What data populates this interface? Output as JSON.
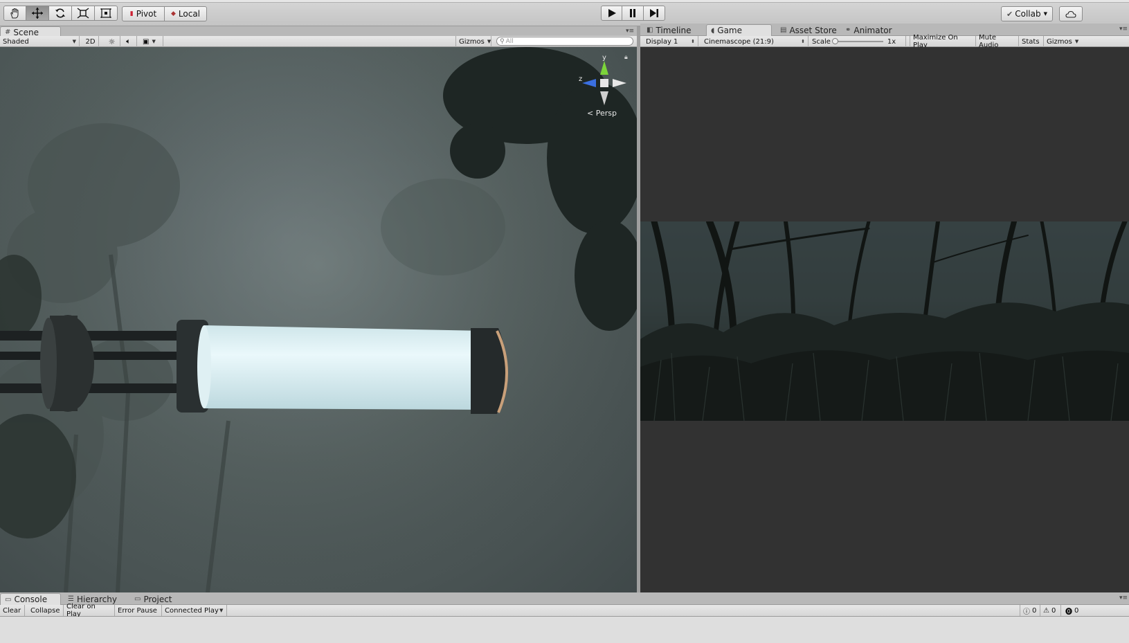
{
  "toolbar": {
    "tools": [
      {
        "name": "hand-tool",
        "icon": "hand-icon"
      },
      {
        "name": "move-tool",
        "icon": "move-arrows-icon"
      },
      {
        "name": "rotate-tool",
        "icon": "rotate-icon"
      },
      {
        "name": "scale-tool",
        "icon": "scale-icon"
      },
      {
        "name": "rect-tool",
        "icon": "rect-transform-icon"
      }
    ],
    "pivot_label": "Pivot",
    "local_label": "Local",
    "collab_label": "Collab",
    "cloud_icon": "cloud-icon",
    "play_icon": "play-icon",
    "pause_icon": "pause-icon",
    "step_icon": "step-icon"
  },
  "scene_panel": {
    "tab_label": "Scene",
    "shading_mode": "Shaded",
    "mode_2d_label": "2D",
    "gizmos_label": "Gizmos",
    "search_placeholder": "All",
    "projection_label": "Persp",
    "axis_y": "y",
    "axis_z": "z"
  },
  "game_panel": {
    "tabs": [
      {
        "label": "Timeline",
        "icon": "timeline-icon"
      },
      {
        "label": "Game",
        "icon": "game-icon"
      },
      {
        "label": "Asset Store",
        "icon": "asset-store-icon"
      },
      {
        "label": "Animator",
        "icon": "animator-icon"
      }
    ],
    "display_label": "Display 1",
    "aspect_label": "Cinemascope (21:9)",
    "scale_label": "Scale",
    "scale_value": "1x",
    "maximize_label": "Maximize On Play",
    "mute_label": "Mute Audio",
    "stats_label": "Stats",
    "gizmos_label": "Gizmos"
  },
  "console_panel": {
    "tabs": [
      {
        "label": "Console",
        "icon": "console-icon"
      },
      {
        "label": "Hierarchy",
        "icon": "hierarchy-icon"
      },
      {
        "label": "Project",
        "icon": "folder-icon"
      }
    ],
    "buttons": [
      "Clear",
      "Collapse",
      "Clear on Play",
      "Error Pause",
      "Connected Player"
    ],
    "counts": {
      "info": "0",
      "warning": "0",
      "error": "0"
    }
  },
  "colors": {
    "toolbar_bg": "#c8c8c8",
    "scene_bg": "#59636a",
    "game_bg": "#323232",
    "tube_glow": "#dff0f4",
    "axis_y": "#7cd43a",
    "axis_z": "#3b6fe0"
  }
}
